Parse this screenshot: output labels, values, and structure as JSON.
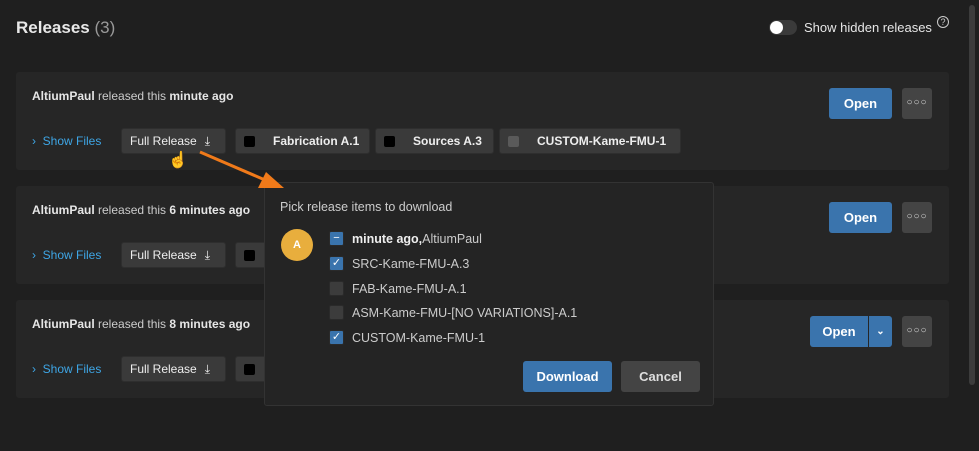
{
  "header": {
    "title": "Releases",
    "count": "(3)",
    "toggle_label": "Show hidden releases",
    "help": "?"
  },
  "releases": [
    {
      "user": "AltiumPaul",
      "mid": " released this ",
      "when": "minute ago",
      "show_files": "Show Files",
      "full_release": "Full Release",
      "chips": [
        "Fabrication A.1",
        "Sources A.3",
        "CUSTOM-Kame-FMU-1"
      ],
      "open": "Open"
    },
    {
      "user": "AltiumPaul",
      "mid": " released this ",
      "when": "6 minutes ago",
      "show_files": "Show Files",
      "full_release": "Full Release",
      "open": "Open"
    },
    {
      "user": "AltiumPaul",
      "mid": " released this ",
      "when": "8 minutes ago",
      "show_files": "Show Files",
      "full_release": "Full Release",
      "open": "Open"
    }
  ],
  "popup": {
    "title": "Pick release items to download",
    "avatar": "A",
    "group_bold": "minute ago,",
    "group_user": "AltiumPaul",
    "items": [
      {
        "label": "SRC-Kame-FMU-A.3",
        "checked": true
      },
      {
        "label": "FAB-Kame-FMU-A.1",
        "checked": false
      },
      {
        "label": "ASM-Kame-FMU-[NO VARIATIONS]-A.1",
        "checked": false
      },
      {
        "label": "CUSTOM-Kame-FMU-1",
        "checked": true
      }
    ],
    "download": "Download",
    "cancel": "Cancel"
  },
  "colors": {
    "accent": "#3a74ad",
    "link": "#3ea6e6",
    "avatar": "#e8ae3d",
    "arrow": "#f07a1a"
  }
}
